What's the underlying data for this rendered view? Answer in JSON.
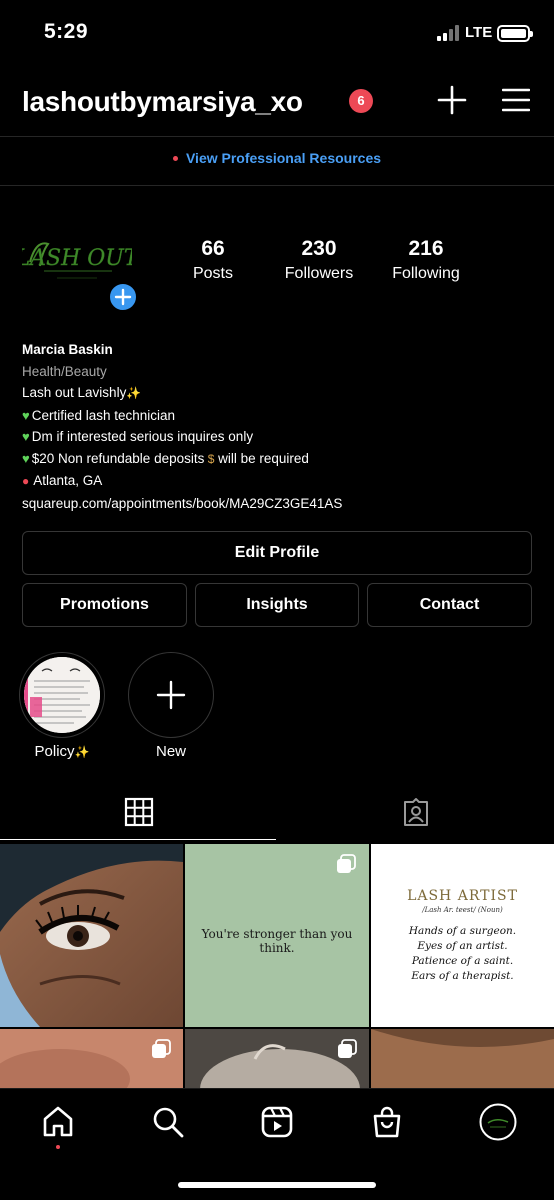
{
  "status_bar": {
    "time": "5:29",
    "network": "LTE",
    "battery_level": 1.0
  },
  "header": {
    "username": "lashoutbymarsiya_xo",
    "notification_count": "6"
  },
  "pro_banner": {
    "label": "View Professional Resources"
  },
  "profile": {
    "logo_text": "LASH OUT",
    "stats": [
      {
        "value": "66",
        "label": "Posts"
      },
      {
        "value": "230",
        "label": "Followers"
      },
      {
        "value": "216",
        "label": "Following"
      }
    ],
    "name": "Marcia Baskin",
    "category": "Health/Beauty",
    "bio_lines": [
      "Lash out Lavishly",
      "Certified lash technician",
      "Dm if interested serious inquires only",
      "$20 Non refundable deposits",
      "will be required",
      "Atlanta, GA"
    ],
    "link": "squareup.com/appointments/book/MA29CZ3GE41AS"
  },
  "buttons": {
    "edit_profile": "Edit Profile",
    "promotions": "Promotions",
    "insights": "Insights",
    "contact": "Contact"
  },
  "highlights": [
    {
      "label": "Policy"
    },
    {
      "label": "New"
    }
  ],
  "tabs": [
    {
      "icon": "grid-icon",
      "active": true
    },
    {
      "icon": "tagged-user-icon",
      "active": false
    }
  ],
  "posts": [
    {
      "type": "photo",
      "multi": false
    },
    {
      "type": "quote",
      "text": "You're stronger than you think.",
      "multi": true
    },
    {
      "type": "graphic",
      "title": "LASH ARTIST",
      "subtitle": "/Lash Ar. teest/ (Noun)",
      "lines": [
        "Hands of a surgeon.",
        "Eyes of an artist.",
        "Patience of a saint.",
        "Ears of a therapist."
      ],
      "multi": false
    },
    {
      "type": "photo",
      "multi": true
    },
    {
      "type": "photo",
      "multi": true
    },
    {
      "type": "photo",
      "multi": false
    }
  ],
  "bottom_nav": [
    {
      "icon": "home-icon",
      "active": true
    },
    {
      "icon": "search-icon"
    },
    {
      "icon": "reels-icon"
    },
    {
      "icon": "shop-icon"
    },
    {
      "icon": "profile-avatar-icon"
    }
  ],
  "colors": {
    "background": "#000000",
    "accent_blue": "#3897f0",
    "link_blue": "#4a9ff5",
    "notification_red": "#ed4956",
    "divider": "#262626",
    "quote_bg": "#a7c4a4"
  }
}
